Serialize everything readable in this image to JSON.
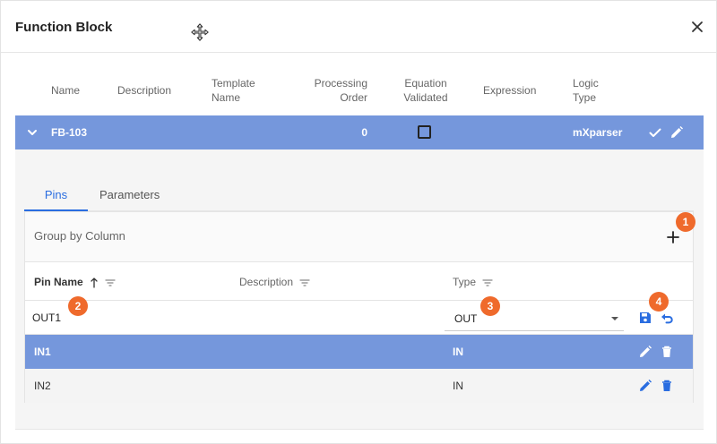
{
  "dialog": {
    "title": "Function Block"
  },
  "grid": {
    "columns": {
      "name": "Name",
      "description": "Description",
      "template_name_1": "Template",
      "template_name_2": "Name",
      "processing_order_1": "Processing",
      "processing_order_2": "Order",
      "equation_validated_1": "Equation",
      "equation_validated_2": "Validated",
      "expression": "Expression",
      "logic_type_1": "Logic",
      "logic_type_2": "Type"
    },
    "row": {
      "name": "FB-103",
      "processing_order": "0",
      "equation_validated": false,
      "logic_type": "mXparser"
    }
  },
  "detail": {
    "tabs": [
      {
        "label": "Pins",
        "active": true
      },
      {
        "label": "Parameters",
        "active": false
      }
    ],
    "group_by": "Group by Column",
    "columns": {
      "pin_name": "Pin Name",
      "description": "Description",
      "type": "Type"
    },
    "edit_row": {
      "pin_name": "OUT1",
      "type": "OUT"
    },
    "rows": [
      {
        "pin_name": "IN1",
        "type": "IN"
      },
      {
        "pin_name": "IN2",
        "type": "IN"
      }
    ]
  },
  "badges": [
    "1",
    "2",
    "3",
    "4"
  ],
  "colors": {
    "row_highlight": "#7597dc",
    "accent": "#2a6de0",
    "badge": "#ef6a2c"
  }
}
